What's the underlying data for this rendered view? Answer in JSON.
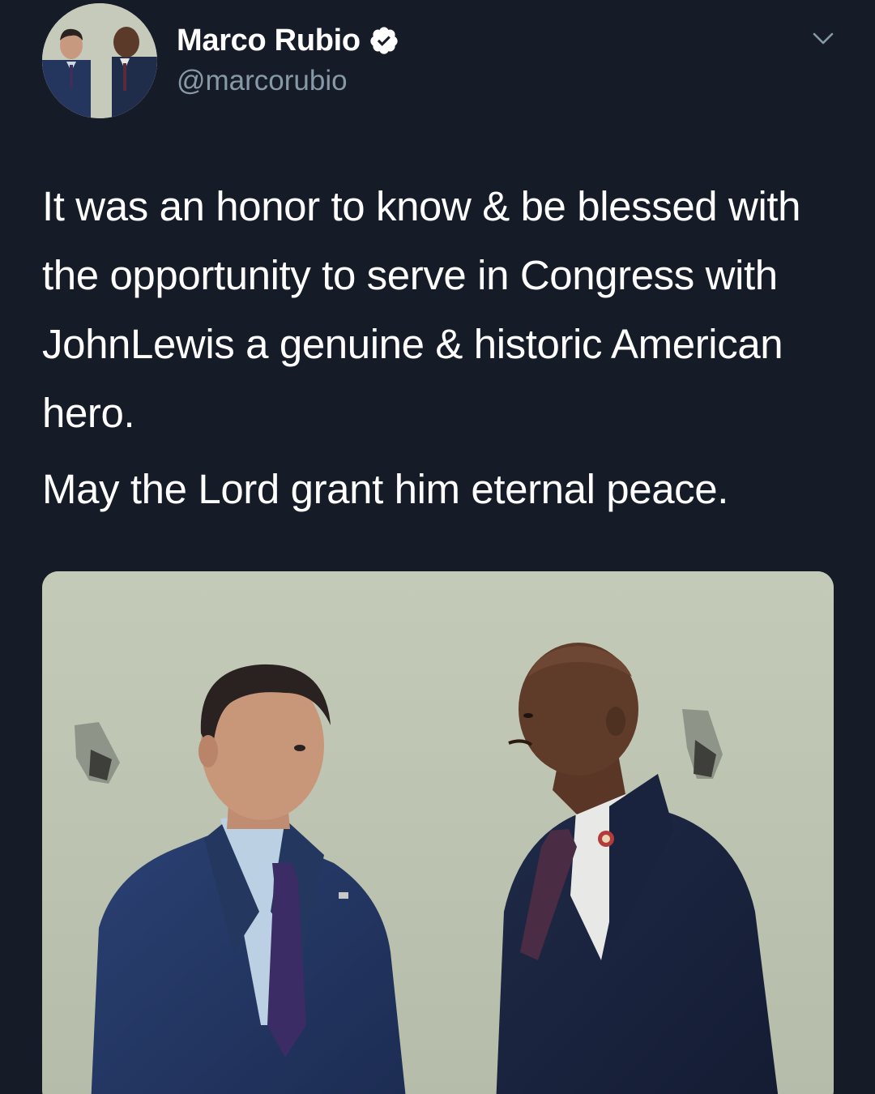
{
  "author": {
    "display_name": "Marco Rubio",
    "handle": "@marcorubio",
    "verified": true,
    "verified_icon": "verified-badge-icon"
  },
  "menu": {
    "icon": "chevron-down-icon"
  },
  "tweet": {
    "paragraphs": [
      "It was an honor to know & be blessed with the opportunity to serve in Congress with JohnLewis a genuine & historic American hero.",
      "May the Lord grant him eternal peace."
    ]
  },
  "media": {
    "type": "photo"
  },
  "colors": {
    "background": "#151c28",
    "text_primary": "#ffffff",
    "text_secondary": "#8899a6",
    "photo_wall": "#bcc3b1"
  }
}
